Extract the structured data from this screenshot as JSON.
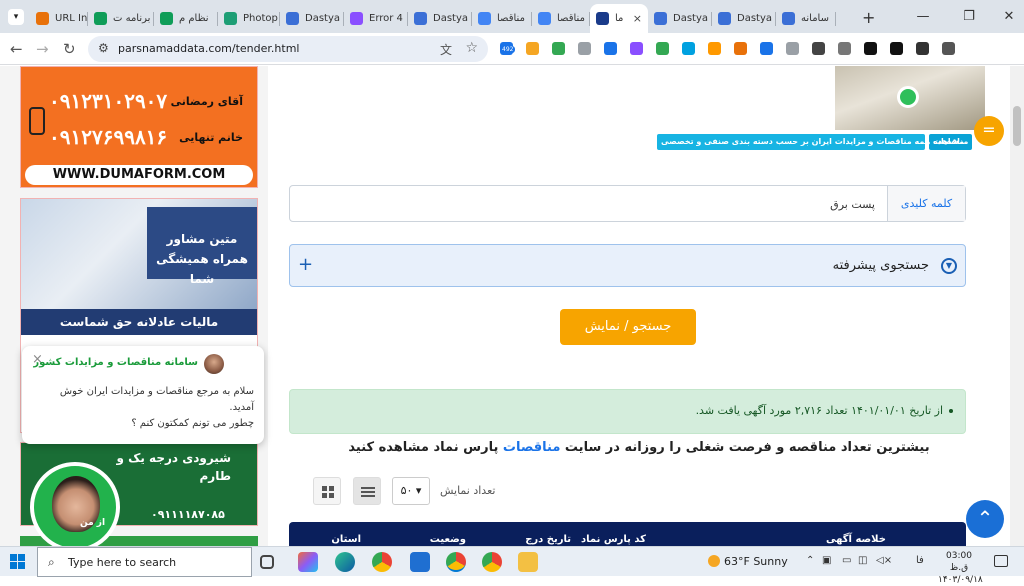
{
  "browser": {
    "tabs": [
      {
        "title": "URL Ins",
        "color": "#e8710a"
      },
      {
        "title": "برنامه ت",
        "color": "#0f9d58"
      },
      {
        "title": "نظام م",
        "color": "#0f9d58"
      },
      {
        "title": "Photop",
        "color": "#1d9e75"
      },
      {
        "title": "Dastya",
        "color": "#3b6fd6"
      },
      {
        "title": "Error 4",
        "color": "#8a4fff"
      },
      {
        "title": "Dastya",
        "color": "#3b6fd6"
      },
      {
        "title": "مناقصا",
        "color": "#4285f4"
      },
      {
        "title": "مناقصا",
        "color": "#4285f4"
      },
      {
        "title": "ما",
        "color": "#1a3b8a"
      },
      {
        "title": "Dastya",
        "color": "#3b6fd6"
      },
      {
        "title": "Dastya",
        "color": "#3b6fd6"
      },
      {
        "title": "سامانه",
        "color": "#3b6fd6"
      }
    ],
    "new_tab": "+",
    "url": "parsnamaddata.com/tender.html",
    "ext_badge": "492"
  },
  "sidebar": {
    "ad1": {
      "name1": "آقای رمضانی",
      "phone1": "۰۹۱۲۳۱۰۲۹۰۷",
      "name2": "خانم تنهایی",
      "phone2": "۰۹۱۲۷۶۹۹۸۱۶",
      "website": "WWW.DUMAFORM.COM"
    },
    "ad2": {
      "line1": "متین مشاور",
      "line2": "همراه همیشگی شما",
      "footer": "مالیات عادلانه حق شماست"
    },
    "ad3": {
      "line1": "شیرودی درجه یک و",
      "line2": "طارم",
      "phone": "۰۹۱۱۱۱۸۷۰۸۵"
    },
    "chat": {
      "title": "سامانه مناقصات و مزایدات کشور",
      "close": "×",
      "message1": "سلام به مرجع مناقصات و مزایدات ایران خوش آمدید.",
      "message2": "چطور می تونم کمکتون کنم ؟"
    },
    "avatar_tag": "از من"
  },
  "content": {
    "crumb_tag": "مناقصات",
    "crumb_text": "مشاهده همه مناقصات و مزایدات ایران بر حسب دسته بندی صنفی و تخصصی",
    "keyword_label": "کلمه کلیدی",
    "keyword_value": "پست برق",
    "advanced_search": "جستجوی پیشرفته",
    "search_button": "جستجو / نمایش",
    "result_text": "از تاریخ ۱۴۰۱/۰۱/۰۱ تعداد ۲,۷۱۶ مورد آگهی یافت شد.",
    "headline_pre": "بیشترین تعداد مناقصه و فرصت شغلی را روزانه در سایت",
    "headline_link": "مناقصات",
    "headline_post": "پارس نماد مشاهده کنید",
    "per_page_label": "تعداد نمایش",
    "per_page_value": "۵۰",
    "table_headers": [
      "خلاصه آگهی",
      "کد پارس نماد",
      "تاریخ درج",
      "وضعیت",
      "استان"
    ]
  },
  "taskbar": {
    "search_placeholder": "Type here to search",
    "weather_temp": "63°F",
    "weather_text": "Sunny",
    "lang": "فا",
    "time": "03:00 ق.ظ",
    "date": "۱۴۰۳/۰۹/۱۸"
  }
}
